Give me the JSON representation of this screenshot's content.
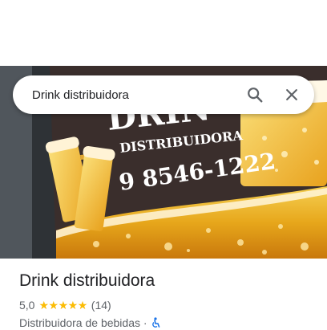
{
  "search": {
    "query": "Drink distribuidora"
  },
  "photo": {
    "sign_brand_text": "DRIN",
    "sign_subtitle": "DISTRIBUIDORA",
    "sign_phone": "9 8546-1222"
  },
  "place": {
    "name": "Drink distribuidora",
    "rating": "5,0",
    "stars": 5,
    "review_count": "(14)",
    "category": "Distribuidora de bebidas ·"
  },
  "colors": {
    "star": "#fbbc04",
    "accessible_icon": "#1a73e8",
    "title_text": "#202124",
    "secondary_text": "#5f6368"
  },
  "icons": [
    "search-icon",
    "close-icon",
    "star-icon",
    "wheelchair-accessible-icon"
  ]
}
